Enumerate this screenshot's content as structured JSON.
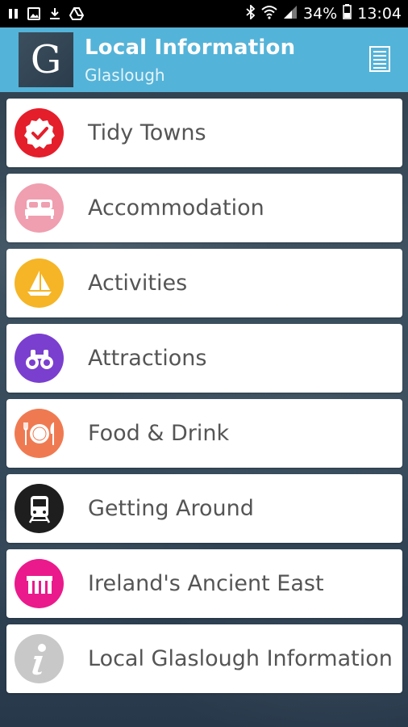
{
  "status_bar": {
    "battery": "34%",
    "time": "13:04"
  },
  "header": {
    "logo_letter": "G",
    "title": "Local Information",
    "subtitle": "Glaslough",
    "bg_color": "#54b3d8"
  },
  "menu": {
    "items": [
      {
        "label": "Tidy Towns",
        "icon": "badge-check-icon",
        "color": "#e41e2b"
      },
      {
        "label": "Accommodation",
        "icon": "bed-icon",
        "color": "#ef9fb0"
      },
      {
        "label": "Activities",
        "icon": "sailboat-icon",
        "color": "#f5b526"
      },
      {
        "label": "Attractions",
        "icon": "binoculars-icon",
        "color": "#7a3fcf"
      },
      {
        "label": "Food & Drink",
        "icon": "plate-cutlery-icon",
        "color": "#ef7a52"
      },
      {
        "label": "Getting Around",
        "icon": "train-icon",
        "color": "#1e1e1e"
      },
      {
        "label": "Ireland's Ancient East",
        "icon": "stone-columns-icon",
        "color": "#ea1a8c"
      },
      {
        "label": "Local Glaslough Information",
        "icon": "info-icon",
        "color": "#c8c8c8"
      }
    ]
  }
}
